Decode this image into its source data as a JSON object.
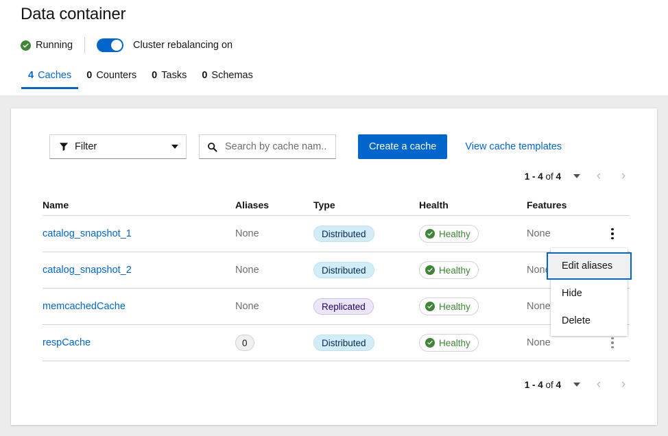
{
  "header": {
    "title": "Data container",
    "status": {
      "icon": "check-circle-icon",
      "label": "Running",
      "color": "#3e8635"
    },
    "rebalancing": {
      "label": "Cluster rebalancing on",
      "state": "on",
      "color": "#0066cc"
    }
  },
  "tabs": [
    {
      "count": "4",
      "label": "Caches",
      "active": true
    },
    {
      "count": "0",
      "label": "Counters",
      "active": false
    },
    {
      "count": "0",
      "label": "Tasks",
      "active": false
    },
    {
      "count": "0",
      "label": "Schemas",
      "active": false
    }
  ],
  "toolbar": {
    "filter_label": "Filter",
    "filter_icon": "funnel-icon",
    "search_icon": "search-icon",
    "search_value": "",
    "search_placeholder": "Search by cache nam...",
    "create_label": "Create a cache",
    "templates_label": "View cache templates"
  },
  "pagination": {
    "range": "1 - 4",
    "of": "of",
    "total": "4",
    "prev_icon": "chevron-left-icon",
    "next_icon": "chevron-right-icon"
  },
  "table": {
    "columns": [
      "Name",
      "Aliases",
      "Type",
      "Health",
      "Features"
    ],
    "rows": [
      {
        "name": "catalog_snapshot_1",
        "aliases": "None",
        "aliases_badge": false,
        "type": "Distributed",
        "type_style": "blue",
        "health": "Healthy",
        "features": "None",
        "kebab": "dark"
      },
      {
        "name": "catalog_snapshot_2",
        "aliases": "None",
        "aliases_badge": false,
        "type": "Distributed",
        "type_style": "blue",
        "health": "Healthy",
        "features": "None",
        "kebab": "dark"
      },
      {
        "name": "memcachedCache",
        "aliases": "None",
        "aliases_badge": false,
        "type": "Replicated",
        "type_style": "purple",
        "health": "Healthy",
        "features": "None",
        "kebab": "dark"
      },
      {
        "name": "respCache",
        "aliases": "0",
        "aliases_badge": true,
        "type": "Distributed",
        "type_style": "blue",
        "health": "Healthy",
        "features": "None",
        "kebab": "light"
      }
    ]
  },
  "dropdown": {
    "open": true,
    "items": [
      {
        "label": "Edit aliases",
        "focused": true
      },
      {
        "label": "Hide",
        "focused": false
      },
      {
        "label": "Delete",
        "focused": false
      }
    ]
  },
  "colors": {
    "accent": "#0066cc",
    "success": "#3e8635",
    "page_bg": "#ececec",
    "border": "#d2d2d2"
  }
}
